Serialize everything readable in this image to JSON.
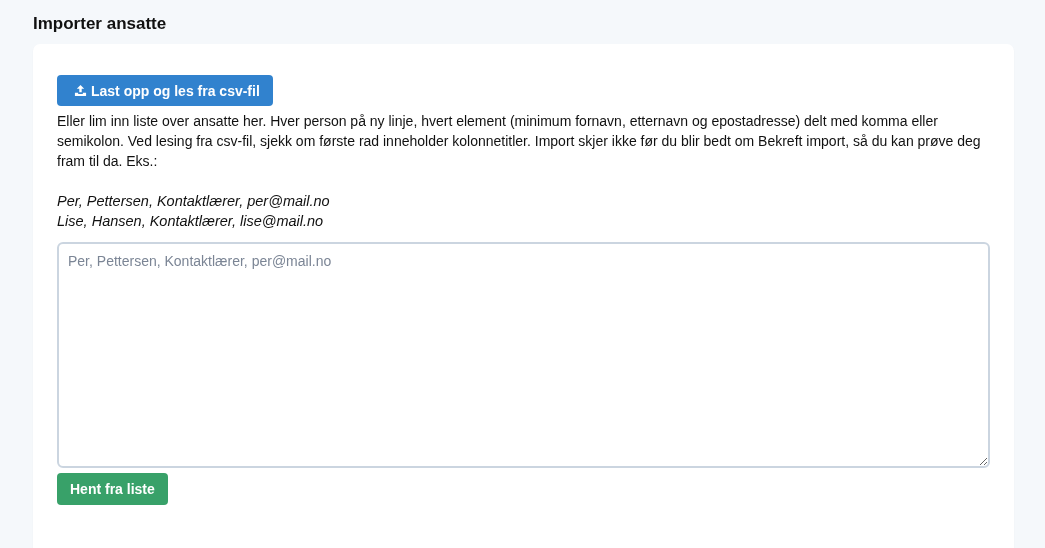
{
  "page": {
    "title": "Importer ansatte"
  },
  "upload_button": {
    "label": "Last opp og les fra csv-fil"
  },
  "instructions": "Eller lim inn liste over ansatte her. Hver person på ny linje, hvert element (minimum fornavn, etternavn og epostadresse) delt med komma eller semikolon. Ved lesing fra csv-fil, sjekk om første rad inneholder kolonnetitler. Import skjer ikke før du blir bedt om Bekreft import, så du kan prøve deg fram til da. Eks.:",
  "examples": [
    "Per, Pettersen, Kontaktlærer, per@mail.no",
    "Lise, Hansen, Kontaktlærer, lise@mail.no"
  ],
  "list_field": {
    "placeholder": "Per, Pettersen, Kontaktlærer, per@mail.no"
  },
  "fetch_button": {
    "label": "Hent fra liste"
  }
}
